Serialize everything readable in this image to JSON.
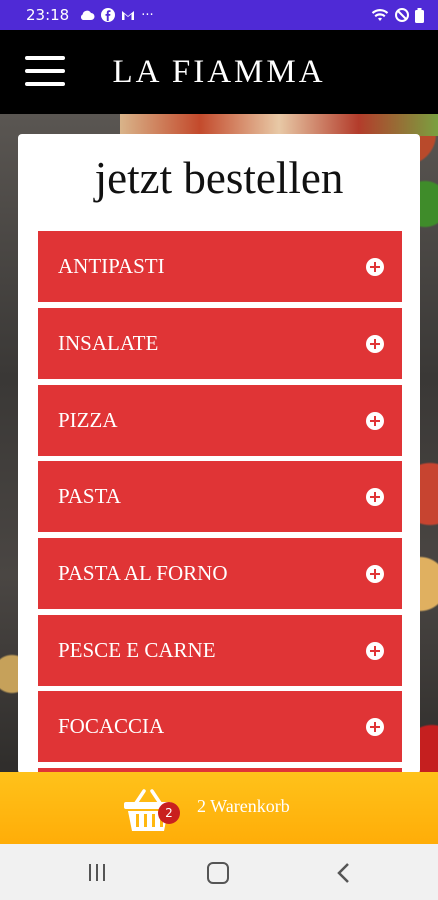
{
  "status": {
    "time": "23:18",
    "more": "···"
  },
  "app": {
    "title": "LA FIAMMA"
  },
  "order": {
    "heading": "jetzt bestellen"
  },
  "categories": [
    {
      "label": "ANTIPASTI"
    },
    {
      "label": "INSALATE"
    },
    {
      "label": "PIZZA"
    },
    {
      "label": "PASTA"
    },
    {
      "label": "PASTA AL FORNO"
    },
    {
      "label": "PESCE E CARNE"
    },
    {
      "label": "FOCACCIA"
    }
  ],
  "cart": {
    "count": "2",
    "label": "2 Warenkorb"
  },
  "icons": {
    "menu": "hamburger-menu-icon",
    "expand": "plus-circle-icon",
    "cart": "basket-icon"
  },
  "colors": {
    "accent_red": "#e03436",
    "cart_yellow": "#ffb80f",
    "status_purple": "#4f2ad6"
  }
}
